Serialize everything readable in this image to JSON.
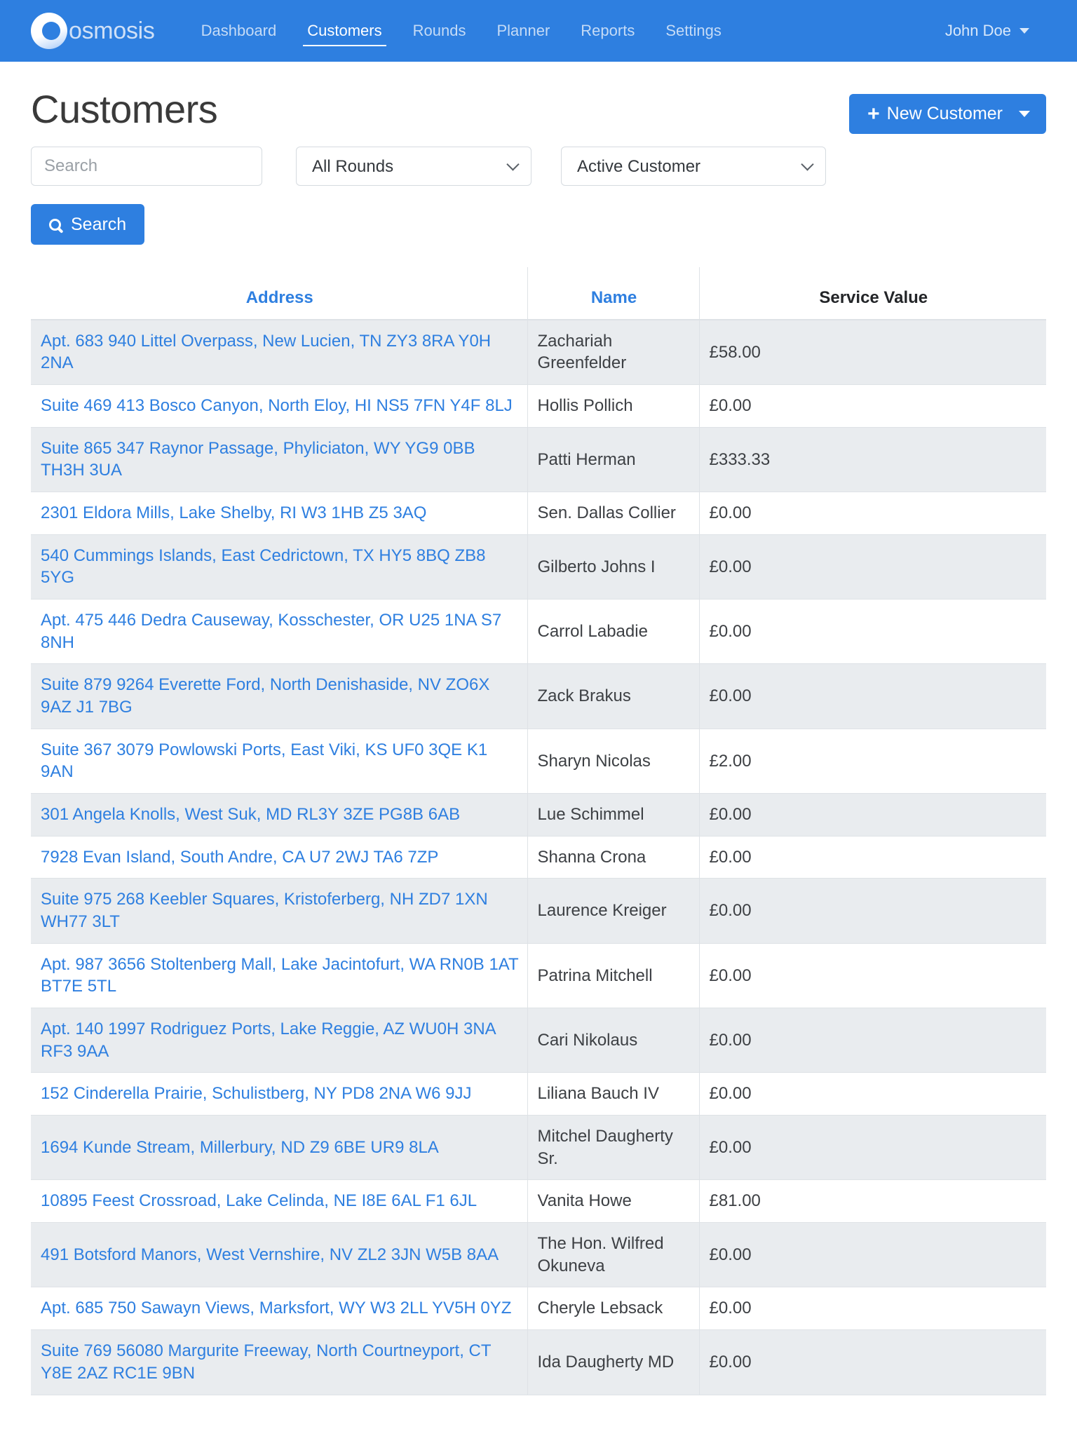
{
  "navbar": {
    "brand": "osmosis",
    "links": [
      {
        "label": "Dashboard",
        "active": false
      },
      {
        "label": "Customers",
        "active": true
      },
      {
        "label": "Rounds",
        "active": false
      },
      {
        "label": "Planner",
        "active": false
      },
      {
        "label": "Reports",
        "active": false
      },
      {
        "label": "Settings",
        "active": false
      }
    ],
    "user": "John Doe"
  },
  "page": {
    "title": "Customers",
    "new_customer_label": "New Customer",
    "new_customer_plus": "+"
  },
  "filters": {
    "search_placeholder": "Search",
    "search_value": "",
    "rounds_selected": "All Rounds",
    "rounds_options": [
      "All Rounds"
    ],
    "status_selected": "Active Customer",
    "status_options": [
      "Active Customer"
    ],
    "search_button_label": "Search"
  },
  "table": {
    "columns": [
      {
        "label": "Address",
        "sortable": true
      },
      {
        "label": "Name",
        "sortable": true
      },
      {
        "label": "Service Value",
        "sortable": false
      }
    ],
    "rows": [
      {
        "address": "Apt. 683 940 Littel Overpass, New Lucien, TN ZY3 8RA Y0H 2NA",
        "name": "Zachariah Greenfelder",
        "value": "£58.00"
      },
      {
        "address": "Suite 469 413 Bosco Canyon, North Eloy, HI NS5 7FN Y4F 8LJ",
        "name": "Hollis Pollich",
        "value": "£0.00"
      },
      {
        "address": "Suite 865 347 Raynor Passage, Phyliciaton, WY YG9 0BB TH3H 3UA",
        "name": "Patti Herman",
        "value": "£333.33"
      },
      {
        "address": "2301 Eldora Mills, Lake Shelby, RI W3 1HB Z5 3AQ",
        "name": "Sen. Dallas Collier",
        "value": "£0.00"
      },
      {
        "address": "540 Cummings Islands, East Cedrictown, TX HY5 8BQ ZB8 5YG",
        "name": "Gilberto Johns I",
        "value": "£0.00"
      },
      {
        "address": "Apt. 475 446 Dedra Causeway, Kosschester, OR U25 1NA S7 8NH",
        "name": "Carrol Labadie",
        "value": "£0.00"
      },
      {
        "address": "Suite 879 9264 Everette Ford, North Denishaside, NV ZO6X 9AZ J1 7BG",
        "name": "Zack Brakus",
        "value": "£0.00"
      },
      {
        "address": "Suite 367 3079 Powlowski Ports, East Viki, KS UF0 3QE K1 9AN",
        "name": "Sharyn Nicolas",
        "value": "£2.00"
      },
      {
        "address": "301 Angela Knolls, West Suk, MD RL3Y 3ZE PG8B 6AB",
        "name": "Lue Schimmel",
        "value": "£0.00"
      },
      {
        "address": "7928 Evan Island, South Andre, CA U7 2WJ TA6 7ZP",
        "name": "Shanna Crona",
        "value": "£0.00"
      },
      {
        "address": "Suite 975 268 Keebler Squares, Kristoferberg, NH ZD7 1XN WH77 3LT",
        "name": "Laurence Kreiger",
        "value": "£0.00"
      },
      {
        "address": "Apt. 987 3656 Stoltenberg Mall, Lake Jacintofurt, WA RN0B 1AT BT7E 5TL",
        "name": "Patrina Mitchell",
        "value": "£0.00"
      },
      {
        "address": "Apt. 140 1997 Rodriguez Ports, Lake Reggie, AZ WU0H 3NA RF3 9AA",
        "name": "Cari Nikolaus",
        "value": "£0.00"
      },
      {
        "address": "152 Cinderella Prairie, Schulistberg, NY PD8 2NA W6 9JJ",
        "name": "Liliana Bauch IV",
        "value": "£0.00"
      },
      {
        "address": "1694 Kunde Stream, Millerbury, ND Z9 6BE UR9 8LA",
        "name": "Mitchel Daugherty Sr.",
        "value": "£0.00"
      },
      {
        "address": "10895 Feest Crossroad, Lake Celinda, NE I8E 6AL F1 6JL",
        "name": "Vanita Howe",
        "value": "£81.00"
      },
      {
        "address": "491 Botsford Manors, West Vernshire, NV ZL2 3JN W5B 8AA",
        "name": "The Hon. Wilfred Okuneva",
        "value": "£0.00"
      },
      {
        "address": "Apt. 685 750 Sawayn Views, Marksfort, WY W3 2LL YV5H 0YZ",
        "name": "Cheryle Lebsack",
        "value": "£0.00"
      },
      {
        "address": "Suite 769 56080 Margurite Freeway, North Courtneyport, CT Y8E 2AZ RC1E 9BN",
        "name": "Ida Daugherty MD",
        "value": "£0.00"
      }
    ]
  },
  "colors": {
    "brand_blue": "#2e7fe0",
    "link_blue": "#2e7fe0",
    "stripe": "#e9ecef",
    "border": "#dee2e6"
  }
}
